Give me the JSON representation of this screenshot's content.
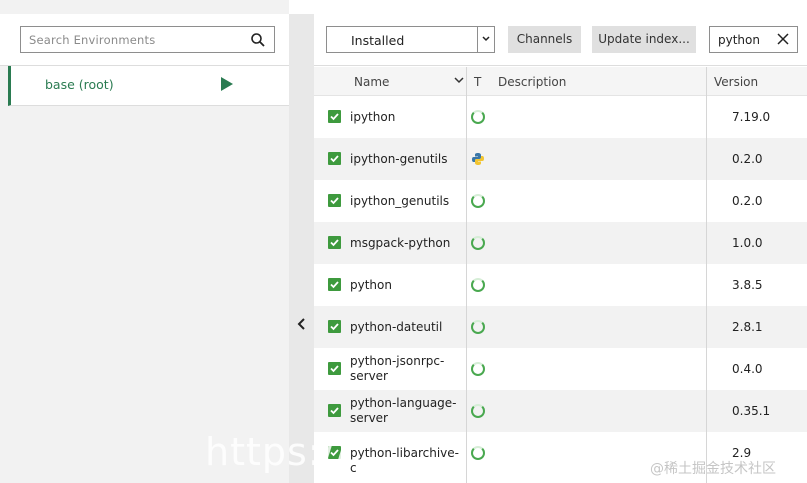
{
  "environments": {
    "search_placeholder": "Search Environments",
    "items": [
      {
        "label": "base (root)"
      }
    ]
  },
  "toolbar": {
    "filter_select": {
      "value": "Installed"
    },
    "channels_label": "Channels",
    "update_index_label": "Update index...",
    "search_value": "python"
  },
  "table": {
    "columns": {
      "name": "Name",
      "type": "T",
      "description": "Description",
      "version": "Version"
    },
    "rows": [
      {
        "name": "ipython",
        "type_icon": "conda-ring-icon",
        "description": "",
        "version": "7.19.0",
        "checked": true
      },
      {
        "name": "ipython-genutils",
        "type_icon": "python-icon",
        "description": "",
        "version": "0.2.0",
        "checked": true
      },
      {
        "name": "ipython_genutils",
        "type_icon": "conda-ring-icon",
        "description": "",
        "version": "0.2.0",
        "checked": true
      },
      {
        "name": "msgpack-python",
        "type_icon": "conda-ring-icon",
        "description": "",
        "version": "1.0.0",
        "checked": true
      },
      {
        "name": "python",
        "type_icon": "conda-ring-icon",
        "description": "",
        "version": "3.8.5",
        "checked": true
      },
      {
        "name": "python-dateutil",
        "type_icon": "conda-ring-icon",
        "description": "",
        "version": "2.8.1",
        "checked": true
      },
      {
        "name": "python-jsonrpc-server",
        "type_icon": "conda-ring-icon",
        "description": "",
        "version": "0.4.0",
        "checked": true
      },
      {
        "name": "python-language-server",
        "type_icon": "conda-ring-icon",
        "description": "",
        "version": "0.35.1",
        "checked": true
      },
      {
        "name": "python-libarchive-c",
        "type_icon": "conda-ring-icon",
        "description": "",
        "version": "2.9",
        "checked": true
      }
    ]
  },
  "colors": {
    "accent_green": "#2a7b51",
    "checkbox_green": "#3e9a3e",
    "ring_green": "#49a84f"
  },
  "watermarks": {
    "url_fragment": "https://",
    "credit": "@稀土掘金技术社区"
  }
}
